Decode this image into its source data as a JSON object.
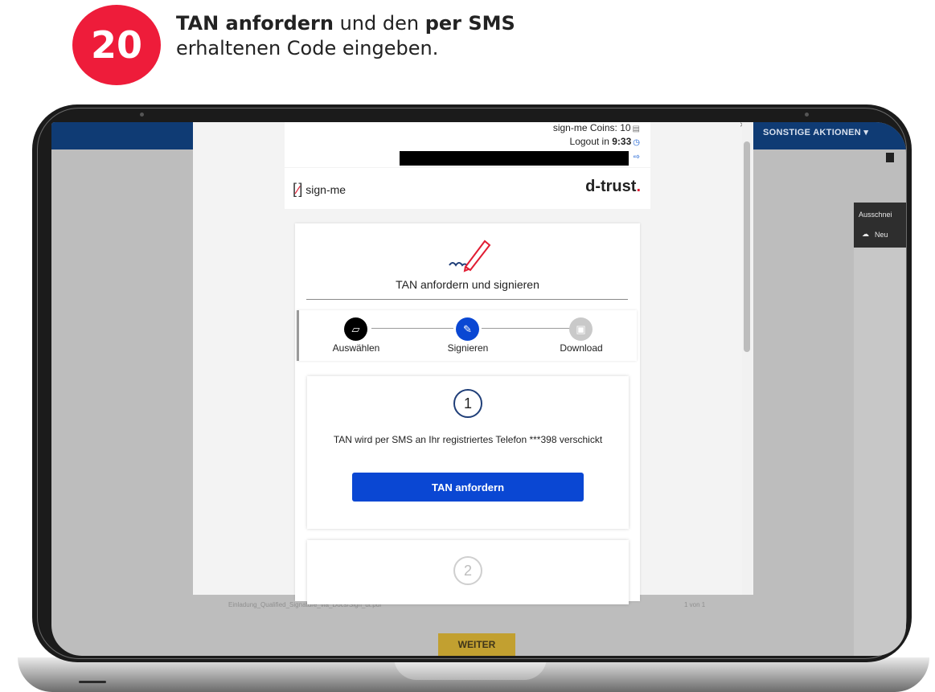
{
  "instruction": {
    "step_number": "20",
    "line1_bold1": "TAN anfordern",
    "line1_mid": " und den ",
    "line1_bold2": "per SMS",
    "line2": "erhaltenen Code eingeben."
  },
  "colors": {
    "badge": "#ee1c3a",
    "primary_button": "#0a47d3",
    "topbar": "#0f3b74",
    "weiter": "#c2a030"
  },
  "background_app": {
    "actions_menu": "SONSTIGE AKTIONEN ▾",
    "panel_title": "Ausschnei",
    "panel_item": "Neu",
    "file_name": "Einladung_Qualified_Signature_via_Docs/Sign_dt.pdf",
    "page_indicator": "1 von 1",
    "weiter_button": "WEITER"
  },
  "modal": {
    "close_symbol": "×",
    "coins_label": "sign-me Coins: 10",
    "logout_label": "Logout in ",
    "logout_time": "9:33",
    "brand_signme": "sign-me",
    "brand_dtrust": "d-trust",
    "brand_dtrust_dot": ".",
    "title": "TAN anfordern und signieren",
    "steps": [
      {
        "label": "Auswählen",
        "icon": "folder-open-icon",
        "state": "done"
      },
      {
        "label": "Signieren",
        "icon": "edit-icon",
        "state": "active"
      },
      {
        "label": "Download",
        "icon": "save-icon",
        "state": "pending"
      }
    ],
    "tan_step_number": "1",
    "tan_message": "TAN wird per SMS an Ihr registriertes Telefon ***398 verschickt",
    "tan_button": "TAN anfordern",
    "next_step_number": "2"
  }
}
